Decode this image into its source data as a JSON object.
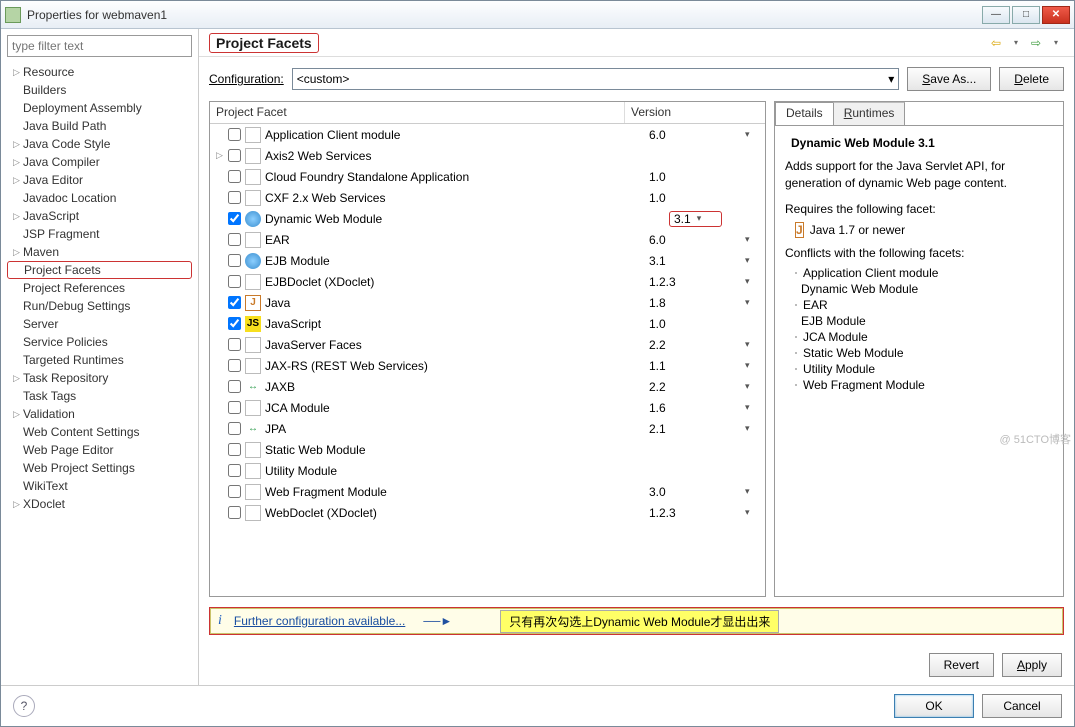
{
  "window": {
    "title": "Properties for webmaven1"
  },
  "filter_placeholder": "type filter text",
  "page_title": "Project Facets",
  "toolbar": {
    "config_label": "Configuration:",
    "config_value": "<custom>",
    "save_as": "Save As...",
    "delete": "Delete"
  },
  "nav_icons": {
    "back": "⇦",
    "back_dd": "▾",
    "fwd": "⇨",
    "fwd_dd": "▾"
  },
  "sidebar": [
    {
      "label": "Resource",
      "exp": true
    },
    {
      "label": "Builders"
    },
    {
      "label": "Deployment Assembly"
    },
    {
      "label": "Java Build Path"
    },
    {
      "label": "Java Code Style",
      "exp": true
    },
    {
      "label": "Java Compiler",
      "exp": true
    },
    {
      "label": "Java Editor",
      "exp": true
    },
    {
      "label": "Javadoc Location"
    },
    {
      "label": "JavaScript",
      "exp": true
    },
    {
      "label": "JSP Fragment"
    },
    {
      "label": "Maven",
      "exp": true
    },
    {
      "label": "Project Facets",
      "selected": true
    },
    {
      "label": "Project References"
    },
    {
      "label": "Run/Debug Settings"
    },
    {
      "label": "Server"
    },
    {
      "label": "Service Policies"
    },
    {
      "label": "Targeted Runtimes"
    },
    {
      "label": "Task Repository",
      "exp": true
    },
    {
      "label": "Task Tags"
    },
    {
      "label": "Validation",
      "exp": true
    },
    {
      "label": "Web Content Settings"
    },
    {
      "label": "Web Page Editor"
    },
    {
      "label": "Web Project Settings"
    },
    {
      "label": "WikiText"
    },
    {
      "label": "XDoclet",
      "exp": true
    }
  ],
  "facet_table": {
    "col_name": "Project Facet",
    "col_ver": "Version",
    "rows": [
      {
        "name": "Application Client module",
        "ver": "6.0",
        "dd": true,
        "icon": "doc"
      },
      {
        "name": "Axis2 Web Services",
        "exp": true,
        "icon": "doc"
      },
      {
        "name": "Cloud Foundry Standalone Application",
        "ver": "1.0",
        "icon": "doc"
      },
      {
        "name": "CXF 2.x Web Services",
        "ver": "1.0",
        "icon": "doc"
      },
      {
        "name": "Dynamic Web Module",
        "ver": "3.1",
        "dd": true,
        "checked": true,
        "icon": "globe",
        "hl": true
      },
      {
        "name": "EAR",
        "ver": "6.0",
        "dd": true,
        "icon": "doc"
      },
      {
        "name": "EJB Module",
        "ver": "3.1",
        "dd": true,
        "icon": "globe"
      },
      {
        "name": "EJBDoclet (XDoclet)",
        "ver": "1.2.3",
        "dd": true,
        "icon": "doc"
      },
      {
        "name": "Java",
        "ver": "1.8",
        "dd": true,
        "checked": true,
        "icon": "java"
      },
      {
        "name": "JavaScript",
        "ver": "1.0",
        "checked": true,
        "icon": "js"
      },
      {
        "name": "JavaServer Faces",
        "ver": "2.2",
        "dd": true,
        "icon": "doc"
      },
      {
        "name": "JAX-RS (REST Web Services)",
        "ver": "1.1",
        "dd": true,
        "icon": "doc"
      },
      {
        "name": "JAXB",
        "ver": "2.2",
        "dd": true,
        "icon": "green"
      },
      {
        "name": "JCA Module",
        "ver": "1.6",
        "dd": true,
        "icon": "doc"
      },
      {
        "name": "JPA",
        "ver": "2.1",
        "dd": true,
        "icon": "green"
      },
      {
        "name": "Static Web Module",
        "icon": "doc"
      },
      {
        "name": "Utility Module",
        "icon": "doc"
      },
      {
        "name": "Web Fragment Module",
        "ver": "3.0",
        "dd": true,
        "icon": "doc"
      },
      {
        "name": "WebDoclet (XDoclet)",
        "ver": "1.2.3",
        "dd": true,
        "icon": "doc"
      }
    ]
  },
  "details": {
    "tab_details": "Details",
    "tab_runtimes": "Runtimes",
    "title": "Dynamic Web Module 3.1",
    "desc": "Adds support for the Java Servlet API, for generation of dynamic Web page content.",
    "requires_label": "Requires the following facet:",
    "requires": [
      {
        "icon": "java",
        "label": "Java 1.7 or newer"
      }
    ],
    "conflicts_label": "Conflicts with the following facets:",
    "conflicts": [
      {
        "icon": "doc",
        "label": "Application Client module"
      },
      {
        "icon": "globe",
        "label": "Dynamic Web Module"
      },
      {
        "icon": "doc",
        "label": "EAR"
      },
      {
        "icon": "globe",
        "label": "EJB Module"
      },
      {
        "icon": "doc",
        "label": "JCA Module"
      },
      {
        "icon": "doc",
        "label": "Static Web Module"
      },
      {
        "icon": "doc",
        "label": "Utility Module"
      },
      {
        "icon": "doc",
        "label": "Web Fragment Module"
      }
    ]
  },
  "info_bar": {
    "link": "Further configuration available...",
    "note": "只有再次勾选上Dynamic Web Module才显出出来"
  },
  "footer": {
    "revert": "Revert",
    "apply": "Apply",
    "ok": "OK",
    "cancel": "Cancel"
  },
  "watermark": "@ 51CTO博客"
}
